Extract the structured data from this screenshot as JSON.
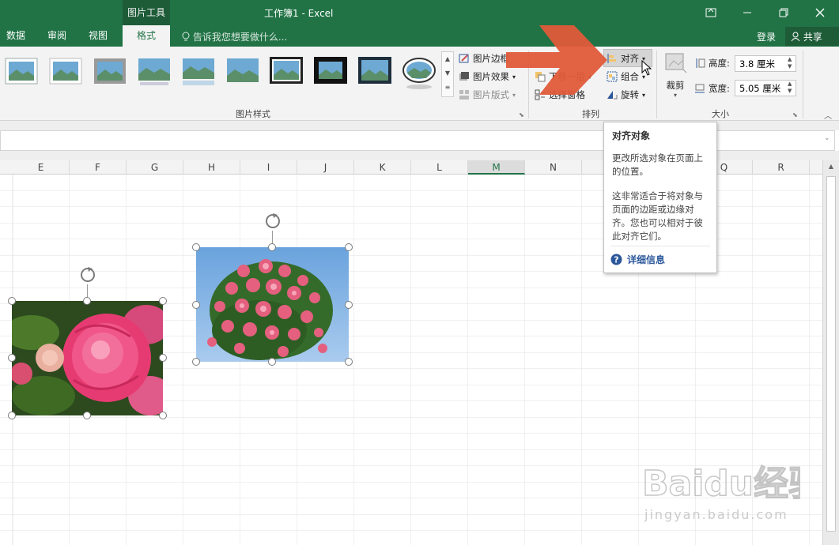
{
  "titlebar": {
    "context_group": "图片工具",
    "doc_title": "工作簿1 - Excel"
  },
  "tabs": [
    {
      "label": "数据"
    },
    {
      "label": "审阅"
    },
    {
      "label": "视图"
    },
    {
      "label": "格式",
      "active": true
    }
  ],
  "tell_me": "告诉我您想要做什么...",
  "account": {
    "login": "登录",
    "share": "共享"
  },
  "ribbon": {
    "picture_styles_group": "图片样式",
    "border": "图片边框",
    "effects": "图片效果",
    "layout": "图片版式",
    "arrange_group": "排列",
    "send_backward": "下移一层",
    "selection_pane": "选择窗格",
    "align": "对齐",
    "group": "组合",
    "rotate": "旋转",
    "size_group": "大小",
    "crop": "裁剪",
    "height_label": "高度:",
    "height_value": "3.8 厘米",
    "width_label": "宽度:",
    "width_value": "5.05 厘米"
  },
  "columns": [
    {
      "label": "E"
    },
    {
      "label": "F"
    },
    {
      "label": "G"
    },
    {
      "label": "H"
    },
    {
      "label": "I"
    },
    {
      "label": "J"
    },
    {
      "label": "K"
    },
    {
      "label": "L"
    },
    {
      "label": "M",
      "selected": true
    },
    {
      "label": "N"
    },
    {
      "label": "O"
    },
    {
      "label": "P"
    },
    {
      "label": "Q"
    },
    {
      "label": "R"
    }
  ],
  "tooltip": {
    "title": "对齐对象",
    "p1": "更改所选对象在页面上的位置。",
    "p2": "这非常适合于将对象与页面的边距或边缘对齐。您也可以相对于彼此对齐它们。",
    "more": "详细信息"
  },
  "watermark": {
    "brand": "Baidu经验",
    "url": "jingyan.baidu.com"
  },
  "colors": {
    "excel_green": "#217346",
    "arrow": "#e05a3a",
    "selection_handle": "#ffffff"
  }
}
